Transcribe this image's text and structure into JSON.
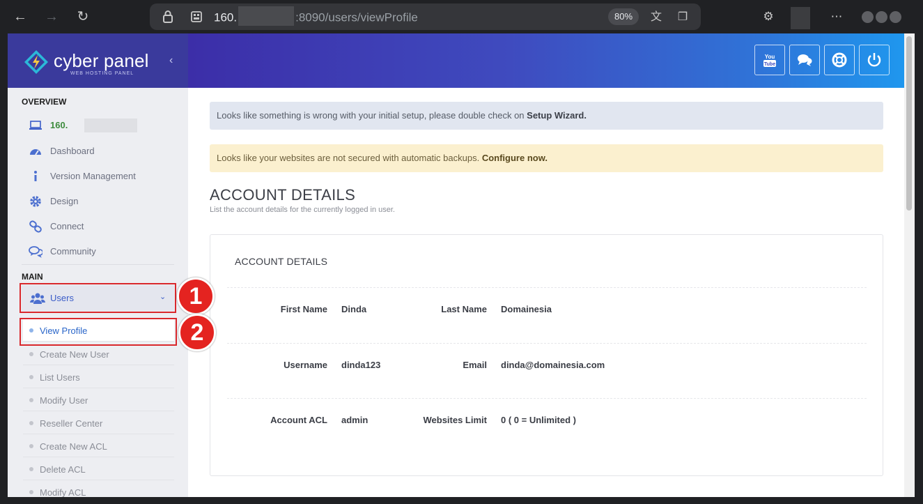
{
  "browser": {
    "url_prefix": "160.",
    "url_suffix": ":8090/users/viewProfile",
    "zoom": "80%"
  },
  "brand": {
    "name": "cyber panel",
    "tagline": "WEB HOSTING PANEL"
  },
  "sidebar": {
    "overview_heading": "OVERVIEW",
    "server_ip": "160.",
    "overview_items": [
      {
        "label": "Dashboard",
        "icon": "dashboard-icon"
      },
      {
        "label": "Version Management",
        "icon": "info-icon"
      },
      {
        "label": "Design",
        "icon": "gear-icon"
      },
      {
        "label": "Connect",
        "icon": "link-icon"
      },
      {
        "label": "Community",
        "icon": "comments-icon"
      }
    ],
    "main_heading": "MAIN",
    "users_label": "Users",
    "users_submenu": [
      {
        "label": "View Profile",
        "active": true
      },
      {
        "label": "Create New User"
      },
      {
        "label": "List Users"
      },
      {
        "label": "Modify User"
      },
      {
        "label": "Reseller Center"
      },
      {
        "label": "Create New ACL"
      },
      {
        "label": "Delete ACL"
      },
      {
        "label": "Modify ACL"
      }
    ]
  },
  "annotations": {
    "step1": "1",
    "step2": "2",
    "color": "#e42320"
  },
  "alerts": {
    "setup_text": "Looks like something is wrong with your initial setup, please double check on",
    "setup_link": "Setup Wizard.",
    "backup_text": "Looks like your websites are not secured with automatic backups.",
    "backup_link": "Configure now."
  },
  "page": {
    "title": "ACCOUNT DETAILS",
    "subtitle": "List the account details for the currently logged in user."
  },
  "account": {
    "card_title": "ACCOUNT DETAILS",
    "first_name_label": "First Name",
    "first_name": "Dinda",
    "last_name_label": "Last Name",
    "last_name": "Domainesia",
    "username_label": "Username",
    "username": "dinda123",
    "email_label": "Email",
    "email": "dinda@domainesia.com",
    "acl_label": "Account ACL",
    "acl": "admin",
    "websites_limit_label": "Websites Limit",
    "websites_limit": "0 ( 0 = Unlimited )"
  },
  "header_buttons": [
    "youtube-icon",
    "chat-icon",
    "lifebuoy-icon",
    "power-icon"
  ],
  "colors": {
    "sidebar_brand": "#3a3a9c",
    "accent_blue": "#3a5cc8",
    "ip_green": "#3d8b3d"
  }
}
